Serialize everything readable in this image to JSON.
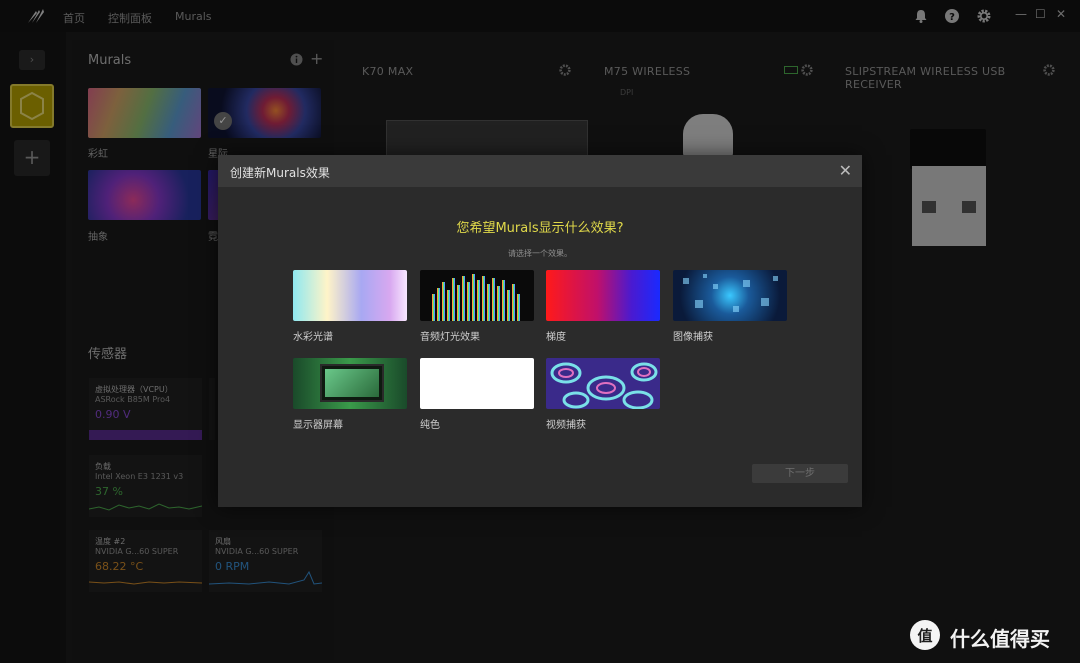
{
  "titlebar": {
    "nav": [
      "首页",
      "控制面板",
      "Murals"
    ],
    "icons": [
      "bell-icon",
      "help-icon",
      "gear-icon"
    ],
    "window_controls": [
      "—",
      "☐",
      "✕"
    ]
  },
  "rail": {
    "collapse_glyph": "›",
    "add_glyph": "+"
  },
  "murals": {
    "title": "Murals",
    "items": [
      {
        "label": "彩虹"
      },
      {
        "label": "星际"
      },
      {
        "label": "抽象"
      },
      {
        "label": "霓"
      }
    ]
  },
  "sensors": {
    "title": "传感器",
    "items": [
      {
        "name": "虚拟处理器（VCPU）",
        "device": "ASRock B85M Pro4",
        "value": "0.90 V",
        "color": "#8a4bd6"
      },
      {
        "name": "负载",
        "device": "Intel Xeon E3 1231 v3",
        "value": "37 %",
        "color": "#4fb04f"
      },
      {
        "name": "温度 #2",
        "device": "NVIDIA G...60 SUPER",
        "value": "68.22 °C",
        "color": "#d08a2a"
      },
      {
        "name": "风扇",
        "device": "NVIDIA G...60 SUPER",
        "value": "0 RPM",
        "color": "#3a8fd6"
      }
    ]
  },
  "devices": [
    {
      "name": "K70 MAX"
    },
    {
      "name": "M75 WIRELESS",
      "dpi_label": "DPI"
    },
    {
      "name": "SLIPSTREAM WIRELESS USB RECEIVER"
    }
  ],
  "modal": {
    "title": "创建新Murals效果",
    "close": "✕",
    "question": "您希望Murals显示什么效果?",
    "subtitle": "请选择一个效果。",
    "options": [
      {
        "label": "水彩光谱"
      },
      {
        "label": "音频灯光效果"
      },
      {
        "label": "梯度"
      },
      {
        "label": "图像捕获"
      },
      {
        "label": "显示器屏幕"
      },
      {
        "label": "纯色"
      },
      {
        "label": "视频捕获"
      }
    ],
    "next": "下一步"
  },
  "watermark": {
    "text": "什么值得买",
    "glyph": "值"
  },
  "colors": {
    "accent": "#e0d94a",
    "tile": "#b9a400"
  }
}
